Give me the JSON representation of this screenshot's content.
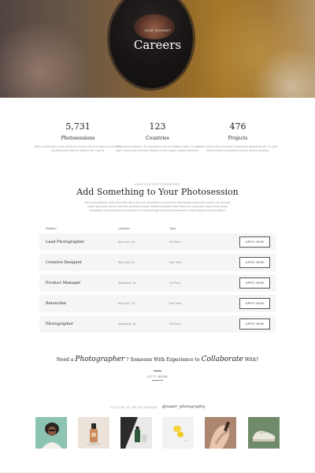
{
  "hero": {
    "kicker": "YOUR JOURNEY",
    "title": "Careers"
  },
  "stats": [
    {
      "number": "5,731",
      "label": "Photosessions",
      "description": "Nam scelerisque, lorem amet dui rutrum velit et fringilla ac erat felis condimentum ultrices pretium non mauris."
    },
    {
      "number": "123",
      "label": "Countries",
      "description": "Suspendisse potenti. Ut consectetur elit nec finibus mattis, cursus ipsum lacus ante pulvinar. Nullam rutrum augue, ornare hendrerit."
    },
    {
      "number": "476",
      "label": "Projects",
      "description": "Lorem ipsum dolor sit amet consectetur adipiscing elit. Ut enim lectus mattis consectetur semper dictum porttitor."
    }
  ],
  "intro": {
    "kicker": "AMATEUR PHOTOGRAPHER",
    "title": "Add Something to Your Photosession",
    "description": "Sed ut perspiciatis unde omnis iste natus error sit voluptatem accusantium doloremque laudantium totam rem aperiam eaque ipsa quae ab illo inventore veritatis et quasi architecto beatae vitae dicta sunt explicabo. Nemo enim ipsam voluptatem quia voluptas sit aspernatur aut odit aut fugit sed quia consequuntur magni dolores eos qui ratione."
  },
  "table": {
    "headers": {
      "position": "Position",
      "location": "Location",
      "type": "Type"
    },
    "apply_label": "APPLY NOW",
    "rows": [
      {
        "position": "Lead Photographer",
        "location": "New York, US",
        "type": "Full Time"
      },
      {
        "position": "Creative Designer",
        "location": "New York, US",
        "type": "Part Time"
      },
      {
        "position": "Product Manager",
        "location": "Rotterdam, NL",
        "type": "Full Time"
      },
      {
        "position": "Retoucher",
        "location": "New York, US",
        "type": "Part Time"
      },
      {
        "position": "Photographer",
        "location": "Rotterdam, NL",
        "type": "Full Time"
      }
    ]
  },
  "cta": {
    "prefix": "Need a",
    "word1": "Photographer",
    "middle": "? Someone With Experience to",
    "word2": "Collaborate",
    "suffix": "With?",
    "link": "LET'S WORK"
  },
  "instagram": {
    "follow_label": "FOLLOW US ON INSTAGRAM",
    "handle": "@super_photography"
  },
  "colors": {
    "accent": "#c08b2a",
    "row_bg": "#f5f5f8",
    "text": "#222222",
    "muted": "#999999"
  }
}
